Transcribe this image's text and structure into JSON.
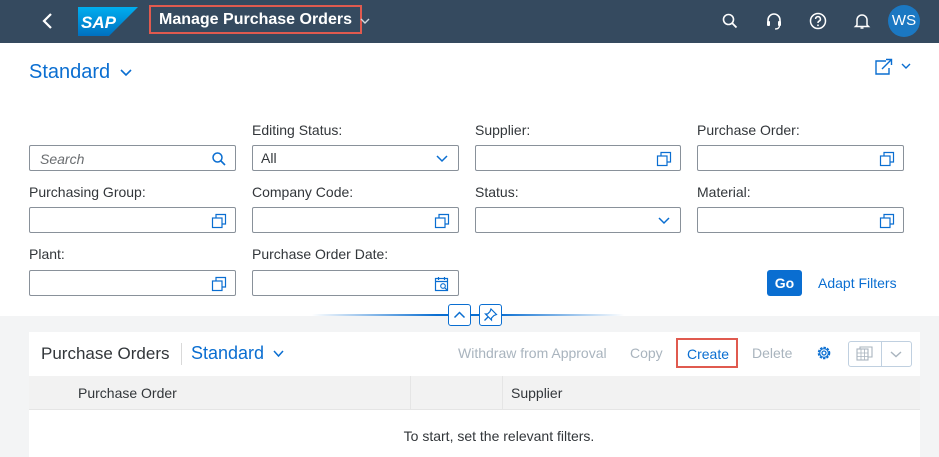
{
  "shell": {
    "app_title": "Manage Purchase Orders",
    "logo_text": "SAP",
    "avatar_initials": "WS",
    "icons": [
      "back-icon",
      "search-icon",
      "headset-icon",
      "help-icon",
      "bell-icon"
    ]
  },
  "header": {
    "variant": "Standard"
  },
  "filters": {
    "search_placeholder": "Search",
    "editing_status": {
      "label": "Editing Status:",
      "value": "All"
    },
    "supplier": {
      "label": "Supplier:"
    },
    "purchase_order": {
      "label": "Purchase Order:"
    },
    "purchasing_group": {
      "label": "Purchasing Group:"
    },
    "company_code": {
      "label": "Company Code:"
    },
    "status": {
      "label": "Status:"
    },
    "material": {
      "label": "Material:"
    },
    "plant": {
      "label": "Plant:"
    },
    "purchase_order_date": {
      "label": "Purchase Order Date:"
    },
    "go_label": "Go",
    "adapt_label": "Adapt Filters"
  },
  "table": {
    "title": "Purchase Orders",
    "variant": "Standard",
    "actions": {
      "withdraw": "Withdraw from Approval",
      "copy": "Copy",
      "create": "Create",
      "delete": "Delete"
    },
    "columns": [
      "Purchase Order",
      "Supplier"
    ],
    "empty_message": "To start, set the relevant filters."
  },
  "colors": {
    "shell_bg": "#354a5f",
    "accent": "#0a6ed1",
    "highlight": "#e05a4f",
    "disabled": "#a9b4be"
  }
}
